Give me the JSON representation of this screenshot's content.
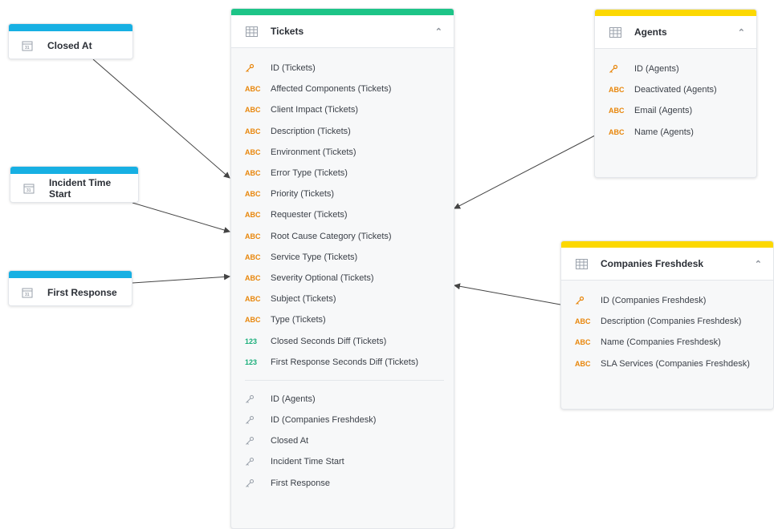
{
  "colors": {
    "tickets_accent": "#1dc487",
    "agents_accent": "#fcd802",
    "companies_accent": "#fcd802",
    "date_accent": "#17b0e3",
    "abc": "#e8860b",
    "number": "#1aae7a"
  },
  "date_cards": [
    {
      "label": "Closed At",
      "icon": "calendar-icon"
    },
    {
      "label": "Incident Time Start",
      "icon": "calendar-icon"
    },
    {
      "label": "First Response",
      "icon": "calendar-icon"
    }
  ],
  "tickets": {
    "title": "Tickets",
    "icon": "table-icon",
    "fields": [
      {
        "type": "key",
        "label": "ID (Tickets)"
      },
      {
        "type": "ABC",
        "label": "Affected Components (Tickets)"
      },
      {
        "type": "ABC",
        "label": "Client Impact (Tickets)"
      },
      {
        "type": "ABC",
        "label": "Description (Tickets)"
      },
      {
        "type": "ABC",
        "label": "Environment (Tickets)"
      },
      {
        "type": "ABC",
        "label": "Error Type (Tickets)"
      },
      {
        "type": "ABC",
        "label": "Priority (Tickets)"
      },
      {
        "type": "ABC",
        "label": "Requester (Tickets)"
      },
      {
        "type": "ABC",
        "label": "Root Cause Category (Tickets)"
      },
      {
        "type": "ABC",
        "label": "Service Type (Tickets)"
      },
      {
        "type": "ABC",
        "label": "Severity Optional (Tickets)"
      },
      {
        "type": "ABC",
        "label": "Subject (Tickets)"
      },
      {
        "type": "ABC",
        "label": "Type (Tickets)"
      },
      {
        "type": "123",
        "label": "Closed Seconds Diff (Tickets)"
      },
      {
        "type": "123",
        "label": "First Response Seconds Diff (Tickets)"
      }
    ],
    "foreign_keys": [
      {
        "label": "ID (Agents)"
      },
      {
        "label": "ID (Companies Freshdesk)"
      },
      {
        "label": "Closed At"
      },
      {
        "label": "Incident Time Start"
      },
      {
        "label": "First Response"
      }
    ]
  },
  "agents": {
    "title": "Agents",
    "icon": "table-icon",
    "fields": [
      {
        "type": "key",
        "label": "ID (Agents)"
      },
      {
        "type": "ABC",
        "label": "Deactivated (Agents)"
      },
      {
        "type": "ABC",
        "label": "Email (Agents)"
      },
      {
        "type": "ABC",
        "label": "Name (Agents)"
      }
    ]
  },
  "companies": {
    "title": "Companies Freshdesk",
    "icon": "table-icon",
    "fields": [
      {
        "type": "key",
        "label": "ID (Companies Freshdesk)"
      },
      {
        "type": "ABC",
        "label": "Description (Companies Freshdesk)"
      },
      {
        "type": "ABC",
        "label": "Name (Companies Freshdesk)"
      },
      {
        "type": "ABC",
        "label": "SLA Services (Companies Freshdesk)"
      }
    ]
  }
}
